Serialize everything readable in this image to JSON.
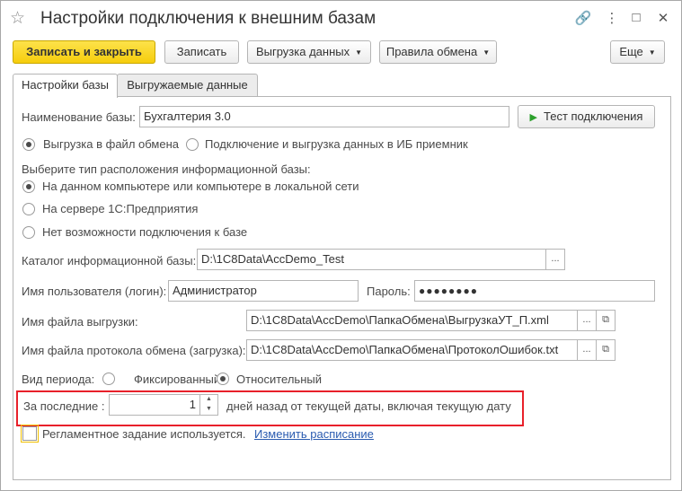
{
  "window": {
    "title": "Настройки подключения к внешним базам",
    "icons": [
      "star-icon",
      "link-icon",
      "more-icon",
      "maximize-icon",
      "close-icon"
    ]
  },
  "toolbar": {
    "save_close": "Записать и закрыть",
    "save": "Записать",
    "export": "Выгрузка данных",
    "rules": "Правила обмена",
    "more": "Еще"
  },
  "tabs": [
    "Настройки базы",
    "Выгружаемые данные"
  ],
  "form": {
    "db_name_label": "Наименование базы:",
    "db_name_value": "Бухгалтерия 3.0",
    "test_button": "Тест подключения",
    "mode_options": [
      "Выгрузка в файл обмена",
      "Подключение и выгрузка данных в ИБ приемник"
    ],
    "mode_selected": 0,
    "location_heading": "Выберите тип расположения информационной базы:",
    "location_options": [
      "На данном компьютере или компьютере в локальной сети",
      "На сервере 1С:Предприятия",
      "Нет возможности подключения к базе"
    ],
    "location_selected": 0,
    "catalog_label": "Каталог информационной базы:",
    "catalog_value": "D:\\1C8Data\\AccDemo_Test",
    "user_label": "Имя пользователя (логин):",
    "user_value": "Администратор",
    "password_label": "Пароль:",
    "password_value": "●●●●●●●●",
    "export_file_label": "Имя файла выгрузки:",
    "export_file_value": "D:\\1C8Data\\AccDemo\\ПапкаОбмена\\ВыгрузкаУТ_П.xml",
    "log_file_label": "Имя файла протокола обмена (загрузка):",
    "log_file_value": "D:\\1C8Data\\AccDemo\\ПапкаОбмена\\ПротоколОшибок.txt",
    "period_label": "Вид периода:",
    "period_options": [
      "Фиксированный",
      "Относительный"
    ],
    "period_selected": 1,
    "last_label": "За последние :",
    "last_value": "1",
    "last_suffix": "дней назад от текущей даты, включая текущую дату",
    "scheduled_label": "Регламентное задание используется.",
    "schedule_link": "Изменить расписание",
    "browse": "...",
    "open": "⧉"
  },
  "colors": {
    "primary_button": "#f6cd0c",
    "highlight_border": "#e8202a",
    "link": "#2a5bb0",
    "test_play": "#2ca02c"
  }
}
